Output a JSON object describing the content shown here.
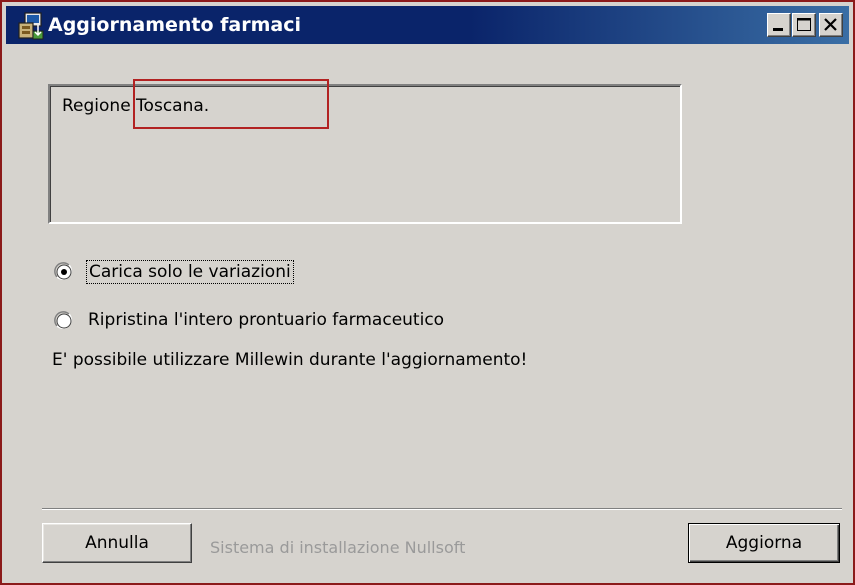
{
  "window": {
    "title": "Aggiornamento farmaci",
    "controls": {
      "minimize": "minimize-icon",
      "maximize": "maximize-icon",
      "close": "close-icon"
    }
  },
  "message_box": {
    "text": "Regione Toscana."
  },
  "options": {
    "selected_index": 0,
    "items": [
      {
        "label": "Carica solo le variazioni",
        "checked": true
      },
      {
        "label": "Ripristina l'intero prontuario farmaceutico",
        "checked": false
      }
    ]
  },
  "info_text": "E' possibile utilizzare Millewin durante l'aggiornamento!",
  "footer": {
    "brand": "Sistema di installazione Nullsoft",
    "cancel_label": "Annulla",
    "update_label": "Aggiorna"
  },
  "colors": {
    "titlebar_start": "#0a246a",
    "titlebar_end": "#3a6ea5",
    "face": "#d6d3ce",
    "window_border": "#8b1a1a",
    "annotation_box": "#b22222"
  }
}
